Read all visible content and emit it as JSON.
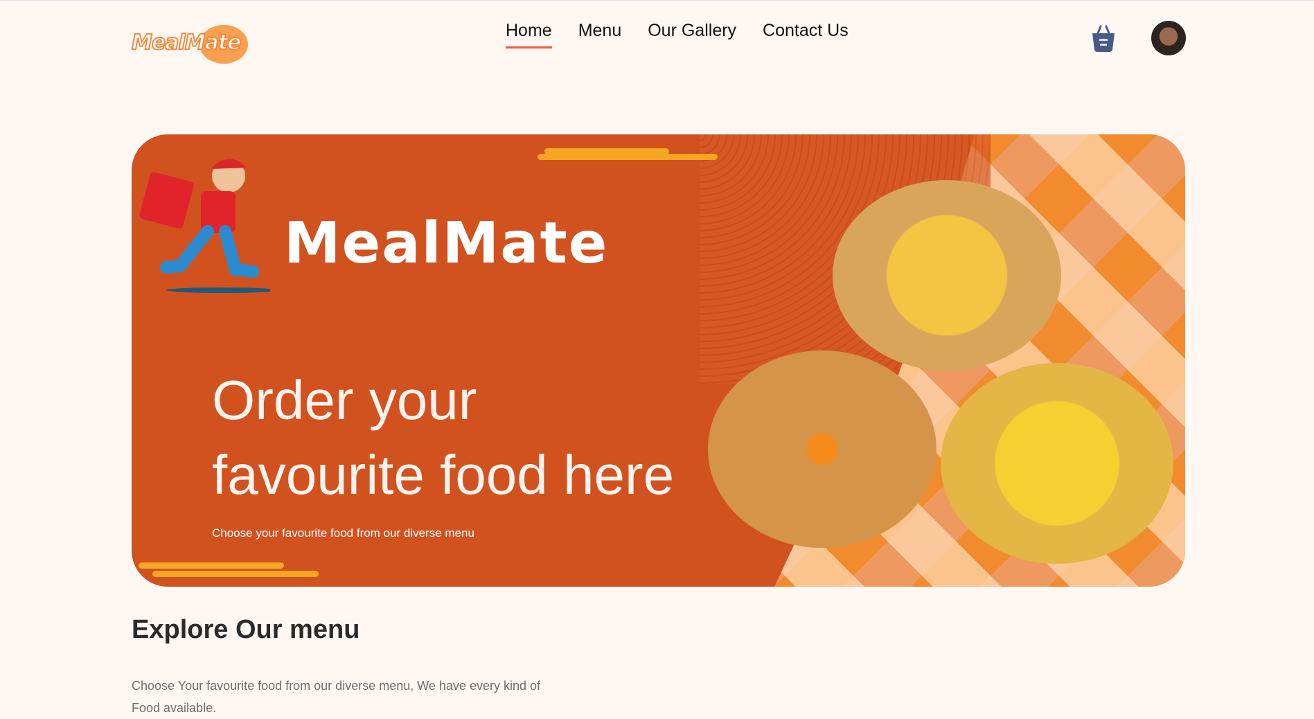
{
  "logo": {
    "text": "MealMate"
  },
  "nav": {
    "items": [
      {
        "label": "Home"
      },
      {
        "label": "Menu"
      },
      {
        "label": "Our Gallery"
      },
      {
        "label": "Contact Us"
      }
    ]
  },
  "hero": {
    "brand": "MealMate",
    "title_line1": "Order your",
    "title_line2": "favourite food here",
    "subtitle": "Choose your favourite food from our diverse menu"
  },
  "menu_section": {
    "heading": "Explore Our menu",
    "description": "Choose Your favourite food from our diverse menu, We have every kind of Food available."
  },
  "colors": {
    "accent": "#d2521f",
    "underline": "#ee5a3b",
    "cart": "#4a5a86"
  }
}
